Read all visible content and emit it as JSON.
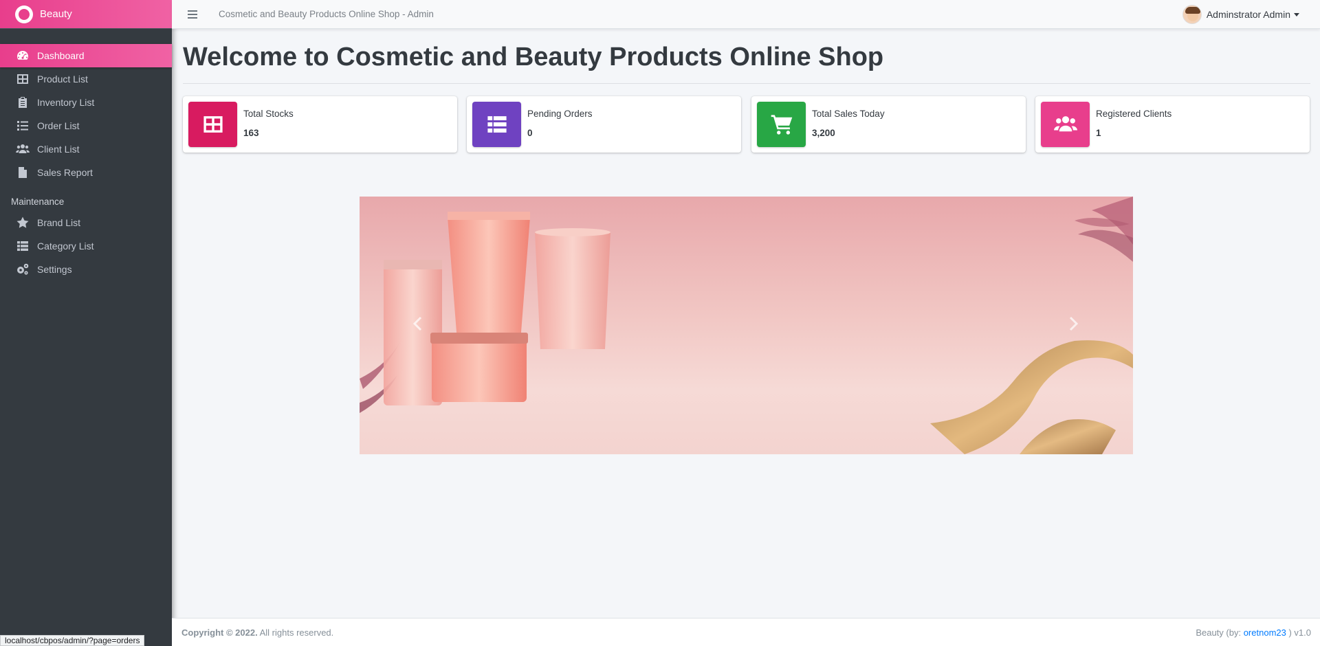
{
  "brand": {
    "name": "Beauty"
  },
  "sidebar": {
    "items": [
      {
        "label": "Dashboard",
        "icon": "dashboard-icon"
      },
      {
        "label": "Product List",
        "icon": "table-icon"
      },
      {
        "label": "Inventory List",
        "icon": "clipboard-icon"
      },
      {
        "label": "Order List",
        "icon": "list-icon"
      },
      {
        "label": "Client List",
        "icon": "users-icon"
      },
      {
        "label": "Sales Report",
        "icon": "file-icon"
      }
    ],
    "section_header": "Maintenance",
    "maintenance_items": [
      {
        "label": "Brand List",
        "icon": "star-icon"
      },
      {
        "label": "Category List",
        "icon": "th-list-icon"
      },
      {
        "label": "Settings",
        "icon": "gears-icon"
      }
    ]
  },
  "topbar": {
    "title": "Cosmetic and Beauty Products Online Shop - Admin",
    "user_name": "Adminstrator Admin"
  },
  "main": {
    "heading": "Welcome to Cosmetic and Beauty Products Online Shop",
    "cards": [
      {
        "label": "Total Stocks",
        "value": "163",
        "icon": "table-icon",
        "color": "#d81b60"
      },
      {
        "label": "Pending Orders",
        "value": "0",
        "icon": "th-list-icon",
        "color": "#6f42c1"
      },
      {
        "label": "Total Sales Today",
        "value": "3,200",
        "icon": "cart-icon",
        "color": "#28a745"
      },
      {
        "label": "Registered Clients",
        "value": "1",
        "icon": "users-icon",
        "color": "#e83e8c"
      }
    ]
  },
  "footer": {
    "copyright": "Copyright © 2022.",
    "rights": "All rights reserved.",
    "credit_prefix": "Beauty (by:",
    "author": "oretnom23",
    "credit_suffix": ") v1.0"
  },
  "status_url": "localhost/cbpos/admin/?page=orders",
  "colors": {
    "accent": "#e83e8c",
    "sidebar_bg": "#343a40",
    "link": "#007bff"
  }
}
